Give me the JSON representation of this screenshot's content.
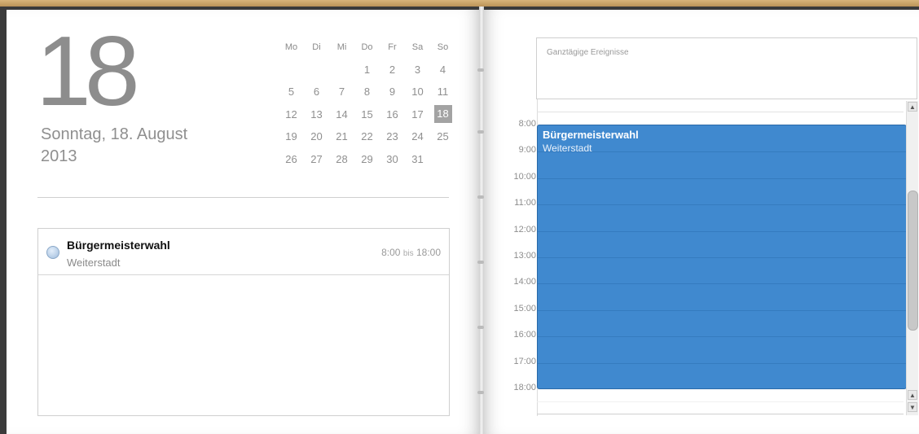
{
  "day_view": {
    "big_day": "18",
    "weekday_date": "Sonntag, 18. August",
    "year": "2013"
  },
  "mini_calendar": {
    "weekdays": [
      "Mo",
      "Di",
      "Mi",
      "Do",
      "Fr",
      "Sa",
      "So"
    ],
    "weeks": [
      [
        "",
        "",
        "",
        "1",
        "2",
        "3",
        "4"
      ],
      [
        "5",
        "6",
        "7",
        "8",
        "9",
        "10",
        "11"
      ],
      [
        "12",
        "13",
        "14",
        "15",
        "16",
        "17",
        "18"
      ],
      [
        "19",
        "20",
        "21",
        "22",
        "23",
        "24",
        "25"
      ],
      [
        "26",
        "27",
        "28",
        "29",
        "30",
        "31",
        ""
      ]
    ],
    "selected_day": "18"
  },
  "event_list": [
    {
      "title": "Bürgermeisterwahl",
      "location": "Weiterstadt",
      "start": "8:00",
      "separator": "bis",
      "end": "18:00"
    }
  ],
  "all_day": {
    "label": "Ganztägige Ereignisse"
  },
  "timeline": {
    "hours": [
      "8:00",
      "9:00",
      "10:00",
      "11:00",
      "12:00",
      "13:00",
      "14:00",
      "15:00",
      "16:00",
      "17:00",
      "18:00"
    ],
    "event": {
      "title": "Bürgermeisterwahl",
      "location": "Weiterstadt"
    }
  },
  "colors": {
    "event_blue": "#4089cf",
    "selected_day": "#a3a3a3"
  }
}
